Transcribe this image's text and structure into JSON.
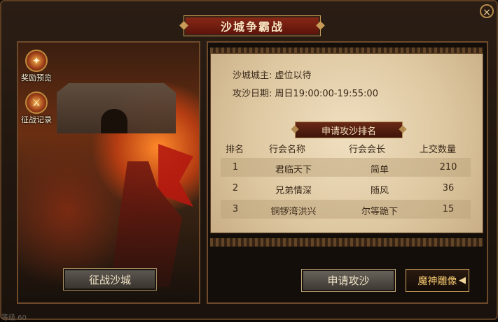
{
  "window": {
    "title": "沙城争霸战",
    "close_label": "×"
  },
  "left": {
    "reward_preview": {
      "label": "奖励预览",
      "icon": "treasure-chest-icon"
    },
    "battle_record": {
      "label": "征战记录",
      "icon": "crossed-swords-icon"
    },
    "attack_button": "征战沙城"
  },
  "info": {
    "owner": "沙城城主: 虚位以待",
    "siege_date": "攻沙日期: 周日19:00:00-19:55:00"
  },
  "ranking": {
    "title": "申请攻沙排名",
    "headers": [
      "排名",
      "行会名称",
      "行会会长",
      "上交数量"
    ],
    "rows": [
      {
        "rank": "1",
        "guild": "君临天下",
        "leader": "简单",
        "amount": "210"
      },
      {
        "rank": "2",
        "guild": "兄弟情深",
        "leader": "随风",
        "amount": "36"
      },
      {
        "rank": "3",
        "guild": "铜锣湾洪兴",
        "leader": "尔等跪下",
        "amount": "15"
      }
    ]
  },
  "buttons": {
    "apply": "申请攻沙",
    "statue": "魔神雕像",
    "statue_arrow": "◀"
  },
  "footer": "等级 60"
}
